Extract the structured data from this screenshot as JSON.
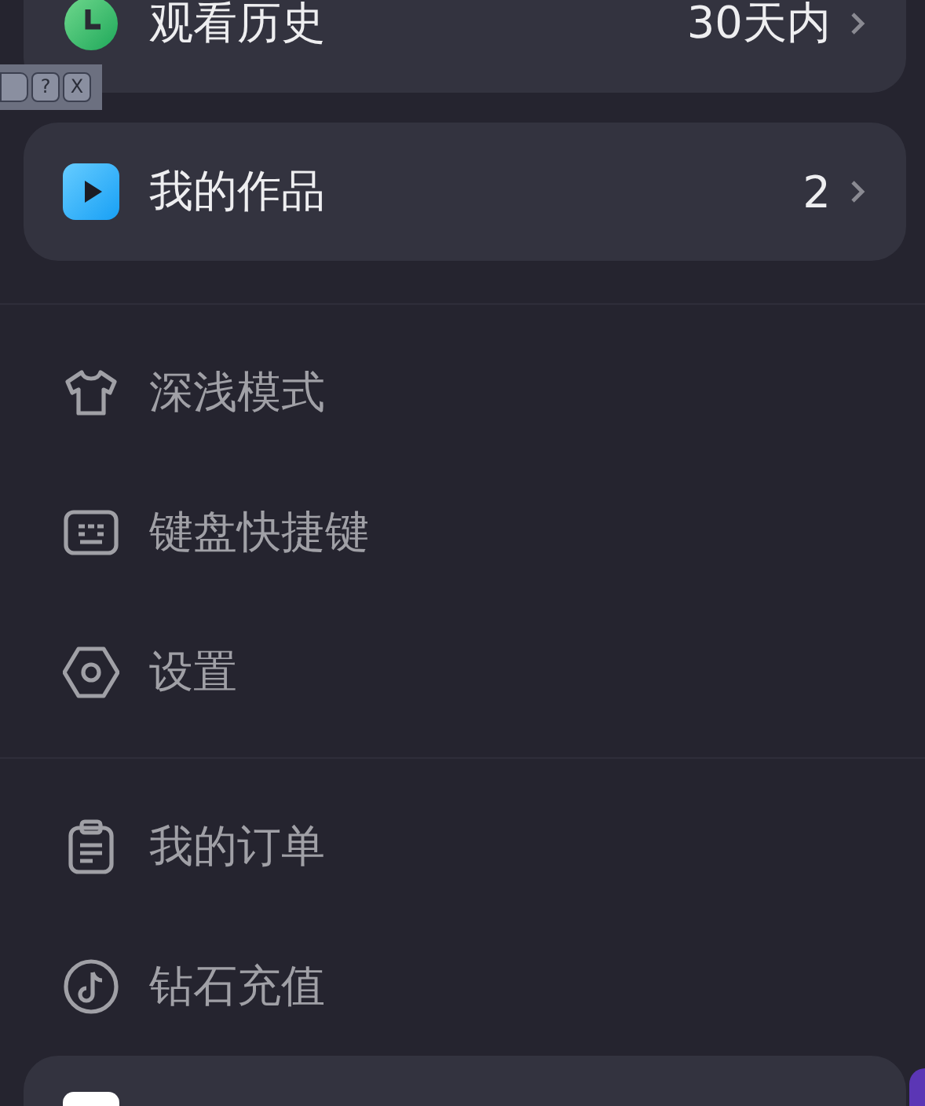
{
  "cards": [
    {
      "label": "观看历史",
      "value": "30天内"
    },
    {
      "label": "我的作品",
      "value": "2"
    }
  ],
  "menu_groups": [
    [
      {
        "label": "深浅模式"
      },
      {
        "label": "键盘快捷键"
      },
      {
        "label": "设置"
      }
    ],
    [
      {
        "label": "我的订单"
      },
      {
        "label": "钻石充值"
      }
    ]
  ],
  "overlay_toolbar": {
    "buttons": [
      "?",
      "X"
    ]
  }
}
